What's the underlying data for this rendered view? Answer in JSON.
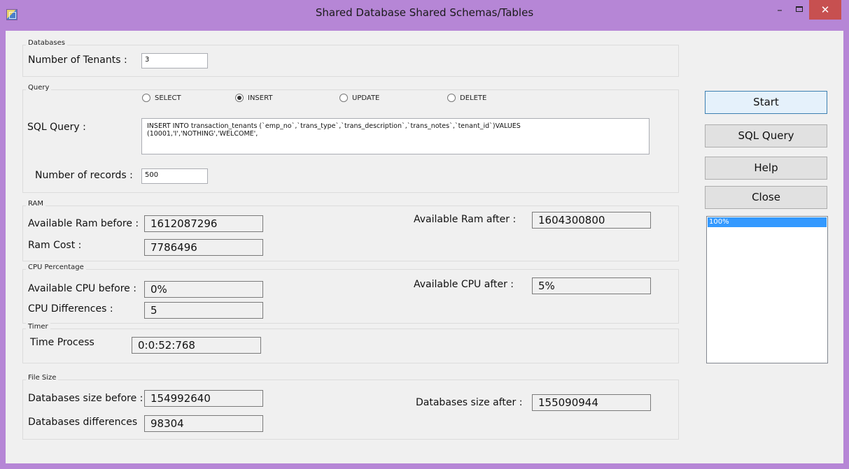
{
  "window": {
    "title": "Shared Database Shared Schemas/Tables",
    "minimize_glyph": "–",
    "close_glyph": "✕"
  },
  "databases": {
    "group_title": "Databases",
    "tenants_label": "Number of Tenants :",
    "tenants_value": "3"
  },
  "query": {
    "group_title": "Query",
    "radio_options": [
      {
        "label": "SELECT",
        "checked": false
      },
      {
        "label": "INSERT",
        "checked": true
      },
      {
        "label": "UPDATE",
        "checked": false
      },
      {
        "label": "DELETE",
        "checked": false
      }
    ],
    "sql_label": "SQL Query  :",
    "sql_text_line1": "INSERT INTO transaction_tenants (`emp_no`,`trans_type`,`trans_description`,`trans_notes`,`tenant_id`)VALUES",
    "sql_text_line2": "(10001,'I','NOTHING','WELCOME',",
    "records_label": "Number of records :",
    "records_value": "500"
  },
  "ram": {
    "group_title": "RAM",
    "before_label": "Available Ram before :",
    "before_value": "1612087296",
    "after_label": "Available Ram after :",
    "after_value": "1604300800",
    "cost_label": "Ram Cost :",
    "cost_value": "7786496"
  },
  "cpu": {
    "group_title": "CPU Percentage",
    "before_label": "Available CPU  before :",
    "before_value": "0%",
    "after_label": "Available CPU after :",
    "after_value": "5%",
    "diff_label": "CPU Differences :",
    "diff_value": "5"
  },
  "timer": {
    "group_title": "Timer",
    "process_label": "Time Process",
    "process_value": "0:0:52:768"
  },
  "filesize": {
    "group_title": "File Size",
    "before_label": "Databases size before :",
    "before_value": "154992640",
    "after_label": "Databases size after :",
    "after_value": "155090944",
    "diff_label": "Databases differences",
    "diff_value": "98304"
  },
  "buttons": {
    "start": "Start",
    "sql_query": "SQL Query",
    "help": "Help",
    "close": "Close"
  },
  "progress_list": {
    "items": [
      "100%"
    ]
  },
  "colors": {
    "titlebar": "#b686d6",
    "client": "#f0f0f0",
    "close_button": "#c75050",
    "selection": "#3399ff"
  }
}
